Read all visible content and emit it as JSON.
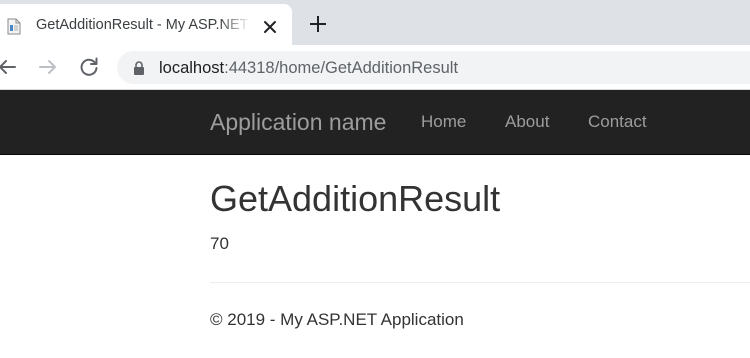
{
  "browser": {
    "tab": {
      "title": "GetAdditionResult - My ASP.NET Application",
      "favicon": "document-page-icon",
      "close_icon": "close-icon"
    },
    "new_tab_icon": "plus-icon",
    "toolbar": {
      "back_icon": "arrow-left-icon",
      "forward_icon": "arrow-right-icon",
      "reload_icon": "reload-icon",
      "lock_icon": "lock-icon",
      "url_host": "localhost",
      "url_rest": ":44318/home/GetAdditionResult"
    }
  },
  "navbar": {
    "brand": "Application name",
    "links": [
      "Home",
      "About",
      "Contact"
    ],
    "background_color": "#222222",
    "text_color": "#9d9d9d"
  },
  "main": {
    "title": "GetAdditionResult",
    "result": "70"
  },
  "footer": {
    "text": "© 2019 - My ASP.NET Application"
  }
}
